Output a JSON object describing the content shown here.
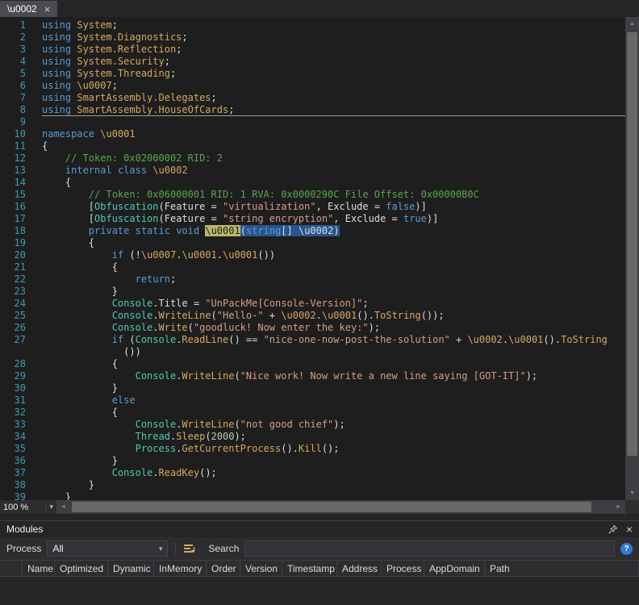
{
  "tab": {
    "title": "\\u0002",
    "close_glyph": "×"
  },
  "editor": {
    "zoom_level": "100 %",
    "dropdown_glyph": "▾",
    "colors": {
      "background": "#1E1E1E",
      "keyword": "#569CD6",
      "identifier_gold": "#D6A85F",
      "type_teal": "#4EC9B0",
      "comment": "#57A64A",
      "string": "#D69D85",
      "number": "#B5CEA8",
      "plain": "#DCDCDC",
      "line_number": "#3D9CB0",
      "definition_highlight": "#BCB76B",
      "selection_highlight": "#29568F"
    },
    "code": {
      "lines": [
        {
          "n": "1",
          "s": [
            [
              "k",
              "using"
            ],
            [
              "p",
              " "
            ],
            [
              "g",
              "System"
            ],
            [
              "p",
              ";"
            ]
          ]
        },
        {
          "n": "2",
          "s": [
            [
              "k",
              "using"
            ],
            [
              "p",
              " "
            ],
            [
              "g",
              "System.Diagnostics"
            ],
            [
              "p",
              ";"
            ]
          ]
        },
        {
          "n": "3",
          "s": [
            [
              "k",
              "using"
            ],
            [
              "p",
              " "
            ],
            [
              "g",
              "System.Reflection"
            ],
            [
              "p",
              ";"
            ]
          ]
        },
        {
          "n": "4",
          "s": [
            [
              "k",
              "using"
            ],
            [
              "p",
              " "
            ],
            [
              "g",
              "System.Security"
            ],
            [
              "p",
              ";"
            ]
          ]
        },
        {
          "n": "5",
          "s": [
            [
              "k",
              "using"
            ],
            [
              "p",
              " "
            ],
            [
              "g",
              "System.Threading"
            ],
            [
              "p",
              ";"
            ]
          ]
        },
        {
          "n": "6",
          "s": [
            [
              "k",
              "using"
            ],
            [
              "p",
              " "
            ],
            [
              "g",
              "\\u0007"
            ],
            [
              "p",
              ";"
            ]
          ]
        },
        {
          "n": "7",
          "s": [
            [
              "k",
              "using"
            ],
            [
              "p",
              " "
            ],
            [
              "g",
              "SmartAssembly.Delegates"
            ],
            [
              "p",
              ";"
            ]
          ]
        },
        {
          "n": "8",
          "rule": true,
          "s": [
            [
              "k",
              "using"
            ],
            [
              "p",
              " "
            ],
            [
              "g",
              "SmartAssembly.HouseOfCards"
            ],
            [
              "p",
              ";"
            ]
          ]
        },
        {
          "n": "9",
          "s": []
        },
        {
          "n": "10",
          "s": [
            [
              "k",
              "namespace"
            ],
            [
              "p",
              " "
            ],
            [
              "g",
              "\\u0001"
            ]
          ]
        },
        {
          "n": "11",
          "s": [
            [
              "p",
              "{"
            ]
          ]
        },
        {
          "n": "12",
          "s": [
            [
              "p",
              "    "
            ],
            [
              "c",
              "// Token: 0x02000002 RID: 2"
            ]
          ]
        },
        {
          "n": "13",
          "s": [
            [
              "p",
              "    "
            ],
            [
              "k",
              "internal"
            ],
            [
              "p",
              " "
            ],
            [
              "k",
              "class"
            ],
            [
              "p",
              " "
            ],
            [
              "g",
              "\\u0002"
            ]
          ]
        },
        {
          "n": "14",
          "s": [
            [
              "p",
              "    {"
            ]
          ]
        },
        {
          "n": "15",
          "s": [
            [
              "p",
              "        "
            ],
            [
              "c",
              "// Token: 0x06000001 RID: 1 RVA: 0x0000290C File Offset: 0x00000B0C"
            ]
          ]
        },
        {
          "n": "16",
          "s": [
            [
              "p",
              "        ["
            ],
            [
              "t",
              "Obfuscation"
            ],
            [
              "p",
              "(Feature = "
            ],
            [
              "s",
              "\"virtualization\""
            ],
            [
              "p",
              ", Exclude = "
            ],
            [
              "k",
              "false"
            ],
            [
              "p",
              ")]"
            ]
          ]
        },
        {
          "n": "17",
          "s": [
            [
              "p",
              "        ["
            ],
            [
              "t",
              "Obfuscation"
            ],
            [
              "p",
              "(Feature = "
            ],
            [
              "s",
              "\"string encryption\""
            ],
            [
              "p",
              ", Exclude = "
            ],
            [
              "k",
              "true"
            ],
            [
              "p",
              ")]"
            ]
          ]
        },
        {
          "n": "18",
          "s": [
            [
              "p",
              "        "
            ],
            [
              "k",
              "private"
            ],
            [
              "p",
              " "
            ],
            [
              "k",
              "static"
            ],
            [
              "p",
              " "
            ],
            [
              "k",
              "void"
            ],
            [
              "p",
              " "
            ],
            [
              "h",
              "\\u0001"
            ],
            [
              "pb",
              "("
            ],
            [
              "kb",
              "string"
            ],
            [
              "pb",
              "[] \\u0002)"
            ]
          ]
        },
        {
          "n": "19",
          "s": [
            [
              "p",
              "        {"
            ]
          ]
        },
        {
          "n": "20",
          "s": [
            [
              "p",
              "            "
            ],
            [
              "k",
              "if"
            ],
            [
              "p",
              " (!"
            ],
            [
              "g",
              "\\u0007"
            ],
            [
              "p",
              "."
            ],
            [
              "g",
              "\\u0001"
            ],
            [
              "p",
              "."
            ],
            [
              "g",
              "\\u0001"
            ],
            [
              "p",
              "())"
            ]
          ]
        },
        {
          "n": "21",
          "s": [
            [
              "p",
              "            {"
            ]
          ]
        },
        {
          "n": "22",
          "s": [
            [
              "p",
              "                "
            ],
            [
              "k",
              "return"
            ],
            [
              "p",
              ";"
            ]
          ]
        },
        {
          "n": "23",
          "s": [
            [
              "p",
              "            }"
            ]
          ]
        },
        {
          "n": "24",
          "s": [
            [
              "p",
              "            "
            ],
            [
              "t",
              "Console"
            ],
            [
              "p",
              ".Title = "
            ],
            [
              "s",
              "\"UnPackMe[Console-Version]\""
            ],
            [
              "p",
              ";"
            ]
          ]
        },
        {
          "n": "25",
          "s": [
            [
              "p",
              "            "
            ],
            [
              "t",
              "Console"
            ],
            [
              "p",
              "."
            ],
            [
              "g",
              "WriteLine"
            ],
            [
              "p",
              "("
            ],
            [
              "s",
              "\"Hello-\""
            ],
            [
              "p",
              " + "
            ],
            [
              "g",
              "\\u0002"
            ],
            [
              "p",
              "."
            ],
            [
              "g",
              "\\u0001"
            ],
            [
              "p",
              "()."
            ],
            [
              "g",
              "ToString"
            ],
            [
              "p",
              "());"
            ]
          ]
        },
        {
          "n": "26",
          "s": [
            [
              "p",
              "            "
            ],
            [
              "t",
              "Console"
            ],
            [
              "p",
              "."
            ],
            [
              "g",
              "Write"
            ],
            [
              "p",
              "("
            ],
            [
              "s",
              "\"goodluck! Now enter the key:\""
            ],
            [
              "p",
              ");"
            ]
          ]
        },
        {
          "n": "27",
          "s": [
            [
              "p",
              "            "
            ],
            [
              "k",
              "if"
            ],
            [
              "p",
              " ("
            ],
            [
              "t",
              "Console"
            ],
            [
              "p",
              "."
            ],
            [
              "g",
              "ReadLine"
            ],
            [
              "p",
              "() == "
            ],
            [
              "s",
              "\"nice-one-now-post-the-solution\""
            ],
            [
              "p",
              " + "
            ],
            [
              "g",
              "\\u0002"
            ],
            [
              "p",
              "."
            ],
            [
              "g",
              "\\u0001"
            ],
            [
              "p",
              "()."
            ],
            [
              "g",
              "ToString"
            ]
          ]
        },
        {
          "n": "",
          "s": [
            [
              "p",
              "              ())"
            ]
          ]
        },
        {
          "n": "28",
          "s": [
            [
              "p",
              "            {"
            ]
          ]
        },
        {
          "n": "29",
          "s": [
            [
              "p",
              "                "
            ],
            [
              "t",
              "Console"
            ],
            [
              "p",
              "."
            ],
            [
              "g",
              "WriteLine"
            ],
            [
              "p",
              "("
            ],
            [
              "s",
              "\"Nice work! Now write a new line saying [GOT-IT]\""
            ],
            [
              "p",
              ");"
            ]
          ]
        },
        {
          "n": "30",
          "s": [
            [
              "p",
              "            }"
            ]
          ]
        },
        {
          "n": "31",
          "s": [
            [
              "p",
              "            "
            ],
            [
              "k",
              "else"
            ]
          ]
        },
        {
          "n": "32",
          "s": [
            [
              "p",
              "            {"
            ]
          ]
        },
        {
          "n": "33",
          "s": [
            [
              "p",
              "                "
            ],
            [
              "t",
              "Console"
            ],
            [
              "p",
              "."
            ],
            [
              "g",
              "WriteLine"
            ],
            [
              "p",
              "("
            ],
            [
              "s",
              "\"not good chief\""
            ],
            [
              "p",
              ");"
            ]
          ]
        },
        {
          "n": "34",
          "s": [
            [
              "p",
              "                "
            ],
            [
              "t",
              "Thread"
            ],
            [
              "p",
              "."
            ],
            [
              "g",
              "Sleep"
            ],
            [
              "p",
              "("
            ],
            [
              "d",
              "2000"
            ],
            [
              "p",
              ");"
            ]
          ]
        },
        {
          "n": "35",
          "s": [
            [
              "p",
              "                "
            ],
            [
              "t",
              "Process"
            ],
            [
              "p",
              "."
            ],
            [
              "g",
              "GetCurrentProcess"
            ],
            [
              "p",
              "()."
            ],
            [
              "g",
              "Kill"
            ],
            [
              "p",
              "();"
            ]
          ]
        },
        {
          "n": "36",
          "s": [
            [
              "p",
              "            }"
            ]
          ]
        },
        {
          "n": "37",
          "s": [
            [
              "p",
              "            "
            ],
            [
              "t",
              "Console"
            ],
            [
              "p",
              "."
            ],
            [
              "g",
              "ReadKey"
            ],
            [
              "p",
              "();"
            ]
          ]
        },
        {
          "n": "38",
          "s": [
            [
              "p",
              "        }"
            ]
          ]
        },
        {
          "n": "39",
          "s": [
            [
              "p",
              "    }"
            ]
          ]
        }
      ]
    }
  },
  "scrollbar": {
    "up_glyph": "▲",
    "down_glyph": "▼",
    "left_glyph": "◄",
    "right_glyph": "►"
  },
  "modules": {
    "title": "Modules",
    "close_glyph": "×",
    "toolbar": {
      "process_label": "Process",
      "process_value": "All",
      "dropdown_glyph": "▾",
      "search_label": "Search",
      "search_value": "",
      "help_glyph": "?"
    },
    "columns": [
      "",
      "Name",
      "Optimized",
      "Dynamic",
      "InMemory",
      "Order",
      "Version",
      "Timestamp",
      "Address",
      "Process",
      "AppDomain",
      "Path"
    ],
    "rows": []
  }
}
